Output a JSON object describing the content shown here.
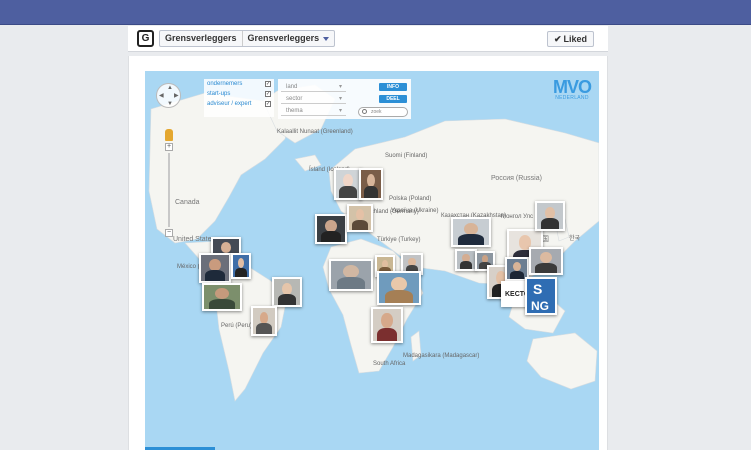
{
  "header": {
    "app_logo": "G",
    "breadcrumb": [
      "Grensverleggers",
      "Grensverleggers"
    ],
    "liked_label": "Liked"
  },
  "map": {
    "filters": [
      {
        "label": "ondernemers",
        "checked": true
      },
      {
        "label": "start-ups",
        "checked": true
      },
      {
        "label": "adviseur / expert",
        "checked": true
      }
    ],
    "selects": [
      "land",
      "sector",
      "thema"
    ],
    "info_button": "INFO",
    "share_button": "DEEL",
    "search_placeholder": "zoek",
    "logo": {
      "title": "MVO",
      "subtitle": "NEDERLAND"
    },
    "labels": [
      "Kalaallit Nunaat (Greenland)",
      "Suomi (Finland)",
      "Россия (Russia)",
      "Ísland (Iceland)",
      "Polska (Poland)",
      "Deutschland (Germany)",
      "Україна (Ukraine)",
      "Казахстан (Kazakhstan)",
      "Монгол Улс (Mongolia)",
      "Canada",
      "United States",
      "México (Mexico)",
      "Türkiye (Turkey)",
      "Perú (Peru)",
      "Madagasikara (Madagascar)",
      "South Africa",
      "中国",
      "한국"
    ],
    "photo_text": [
      "KECTOTA",
      "S",
      "NG"
    ]
  }
}
